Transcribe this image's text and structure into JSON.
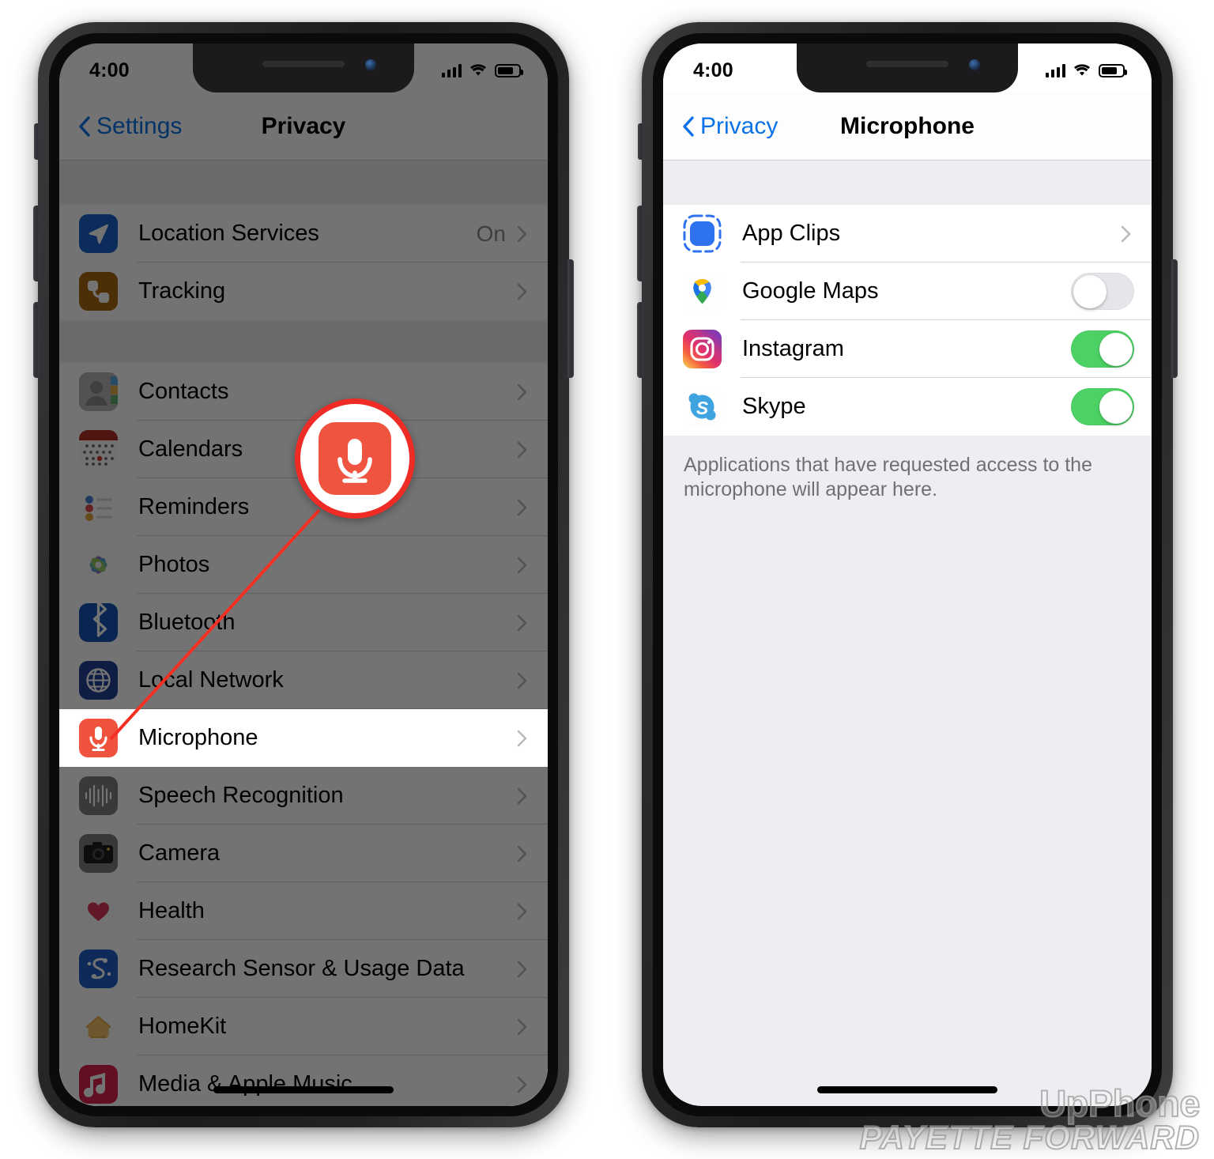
{
  "watermark": {
    "line1": "UpPhone",
    "line2": "PAYETTE FORWARD"
  },
  "phones": [
    {
      "id": "privacy-screen",
      "status": {
        "time": "4:00",
        "battery_pct": 74
      },
      "nav": {
        "back_label": "Settings",
        "title": "Privacy"
      },
      "groups": [
        {
          "rows": [
            {
              "label": "Location Services",
              "icon": "location-services-icon",
              "value": "On",
              "accessory": "chevron"
            },
            {
              "label": "Tracking",
              "icon": "tracking-icon",
              "value": "",
              "accessory": "chevron"
            }
          ]
        },
        {
          "rows": [
            {
              "label": "Contacts",
              "icon": "contacts-icon",
              "value": "",
              "accessory": "chevron"
            },
            {
              "label": "Calendars",
              "icon": "calendars-icon",
              "value": "",
              "accessory": "chevron"
            },
            {
              "label": "Reminders",
              "icon": "reminders-icon",
              "value": "",
              "accessory": "chevron"
            },
            {
              "label": "Photos",
              "icon": "photos-icon",
              "value": "",
              "accessory": "chevron"
            },
            {
              "label": "Bluetooth",
              "icon": "bluetooth-icon",
              "value": "",
              "accessory": "chevron"
            },
            {
              "label": "Local Network",
              "icon": "local-network-icon",
              "value": "",
              "accessory": "chevron"
            },
            {
              "label": "Microphone",
              "icon": "microphone-icon",
              "value": "",
              "accessory": "chevron",
              "highlighted": true
            },
            {
              "label": "Speech Recognition",
              "icon": "speech-recognition-icon",
              "value": "",
              "accessory": "chevron"
            },
            {
              "label": "Camera",
              "icon": "camera-icon",
              "value": "",
              "accessory": "chevron"
            },
            {
              "label": "Health",
              "icon": "health-icon",
              "value": "",
              "accessory": "chevron"
            },
            {
              "label": "Research Sensor & Usage Data",
              "icon": "research-sensor-icon",
              "value": "",
              "accessory": "chevron"
            },
            {
              "label": "HomeKit",
              "icon": "homekit-icon",
              "value": "",
              "accessory": "chevron"
            },
            {
              "label": "Media & Apple Music",
              "icon": "media-apple-music-icon",
              "value": "",
              "accessory": "chevron"
            }
          ]
        }
      ],
      "callout": {
        "icon": "microphone-icon",
        "target_row": "Microphone"
      }
    },
    {
      "id": "microphone-screen",
      "status": {
        "time": "4:00",
        "battery_pct": 74
      },
      "nav": {
        "back_label": "Privacy",
        "title": "Microphone"
      },
      "groups": [
        {
          "rows": [
            {
              "label": "App Clips",
              "icon": "app-clips-icon",
              "accessory": "chevron"
            },
            {
              "label": "Google Maps",
              "icon": "google-maps-icon",
              "accessory": "toggle",
              "toggle_on": false
            },
            {
              "label": "Instagram",
              "icon": "instagram-icon",
              "accessory": "toggle",
              "toggle_on": true
            },
            {
              "label": "Skype",
              "icon": "skype-icon",
              "accessory": "toggle",
              "toggle_on": true
            }
          ]
        }
      ],
      "footnote": "Applications that have requested access to the microphone will appear here."
    }
  ],
  "colors": {
    "ios_blue": "#0a72e8",
    "toggle_on": "#4cd264",
    "toggle_off": "#e6e6ea",
    "callout_red": "#ee2b24",
    "microphone_red": "#ef5440",
    "group_bg": "#eeeef2"
  }
}
